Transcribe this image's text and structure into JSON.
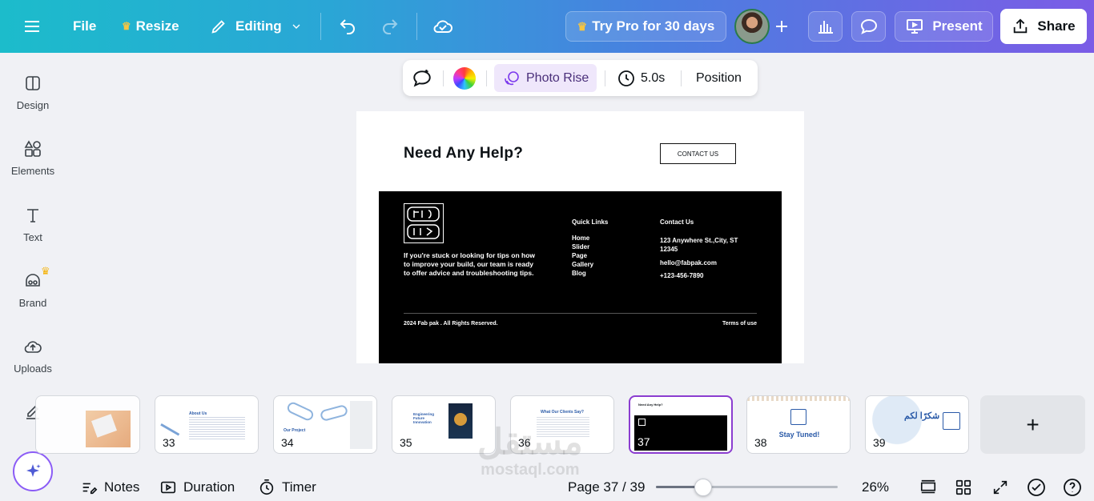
{
  "topbar": {
    "file": "File",
    "resize": "Resize",
    "editing": "Editing",
    "try_pro": "Try Pro for 30 days",
    "present": "Present",
    "share": "Share"
  },
  "sidebar": {
    "items": [
      {
        "label": "Design",
        "icon": "design-icon"
      },
      {
        "label": "Elements",
        "icon": "elements-icon"
      },
      {
        "label": "Text",
        "icon": "text-icon"
      },
      {
        "label": "Brand",
        "icon": "brand-icon"
      },
      {
        "label": "Uploads",
        "icon": "uploads-icon"
      }
    ]
  },
  "floating_toolbar": {
    "animation": "Photo Rise",
    "duration": "5.0s",
    "position": "Position"
  },
  "page": {
    "heading": "Need Any Help?",
    "contact_button": "CONTACT US",
    "description": "If you're stuck or looking for tips on how to improve your build, our team is ready to offer advice and troubleshooting tips.",
    "quick_links_title": "Quick Links",
    "quick_links": [
      "Home",
      "Slider",
      "Page",
      "Gallery",
      "Blog"
    ],
    "contact_title": "Contact Us",
    "address": "123 Anywhere St.,City, ST 12345",
    "email": "hello@fabpak.com",
    "phone": "+123-456-7890",
    "copyright": "2024 Fab pak . All Rights Reserved.",
    "terms": "Terms of use"
  },
  "thumbnails": [
    {
      "num": "",
      "title": ""
    },
    {
      "num": "33",
      "title": "About Us"
    },
    {
      "num": "34",
      "title": "Our Project"
    },
    {
      "num": "35",
      "title": "Engineering Future Innovation"
    },
    {
      "num": "36",
      "title": "What Our Clients Say?"
    },
    {
      "num": "37",
      "title": "Need Any Help?"
    },
    {
      "num": "38",
      "title": "Stay Tuned!"
    },
    {
      "num": "39",
      "title": "شكرًا لكم"
    }
  ],
  "bottombar": {
    "notes": "Notes",
    "duration": "Duration",
    "timer": "Timer",
    "page_indicator": "Page 37 / 39",
    "zoom": "26%",
    "zoom_value": 0.26
  },
  "watermark": {
    "arabic": "مستقل",
    "latin": "mostaql.com"
  },
  "colors": {
    "accent": "#8b3dd0",
    "gradient_start": "#1cbccb",
    "gradient_end": "#7b5ce6"
  }
}
